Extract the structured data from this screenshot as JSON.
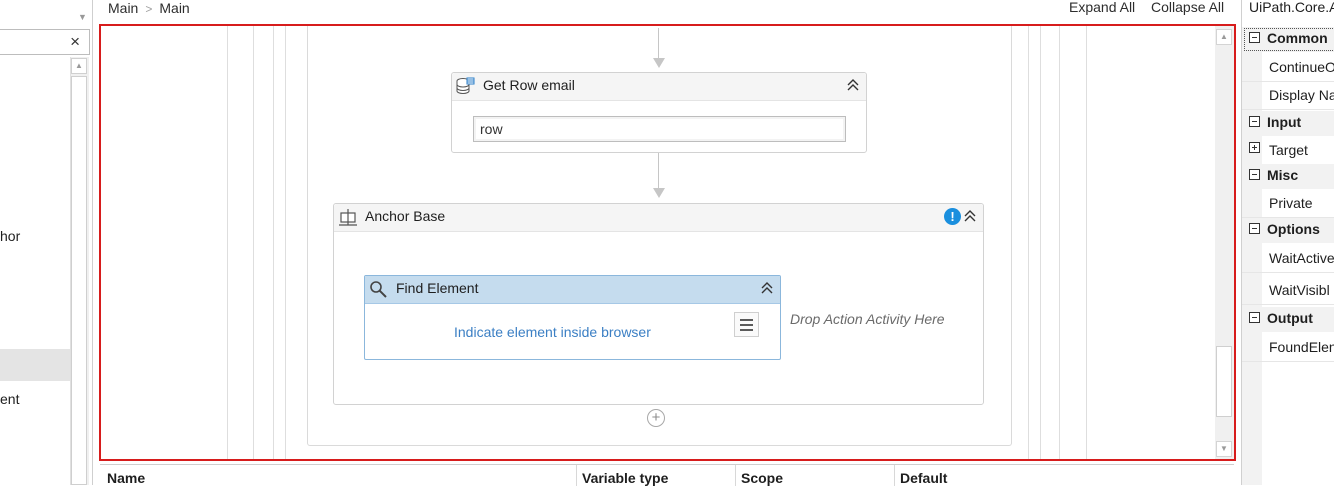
{
  "left_panel": {
    "items": [
      {
        "label": "hor"
      },
      {
        "label": "ent"
      }
    ],
    "clear_glyph": "×"
  },
  "breadcrumb": {
    "items": [
      "Main",
      "Main"
    ]
  },
  "toolbar": {
    "expand_all": "Expand All",
    "collapse_all": "Collapse All"
  },
  "canvas": {
    "get_row": {
      "title": "Get Row email",
      "input_value": "row",
      "icon": "data-row-icon"
    },
    "anchor_base": {
      "title": "Anchor Base",
      "icon": "anchor-icon",
      "warning_glyph": "!"
    },
    "find_element": {
      "title": "Find Element",
      "indicate_link": "Indicate element inside browser",
      "icon": "search-icon"
    },
    "drop_hint": "Drop Action Activity Here",
    "add_glyph": "+"
  },
  "variables_panel": {
    "columns": [
      "Name",
      "Variable type",
      "Scope",
      "Default"
    ]
  },
  "properties": {
    "title": "UiPath.Core.A",
    "categories": [
      {
        "label": "Common",
        "items": [
          "ContinueO",
          "Display Na"
        ]
      },
      {
        "label": "Input",
        "items": [
          "Target"
        ]
      },
      {
        "label": "Misc",
        "items": [
          "Private"
        ]
      },
      {
        "label": "Options",
        "items": [
          "WaitActive",
          "WaitVisibl"
        ]
      },
      {
        "label": "Output",
        "items": [
          "FoundElen"
        ]
      }
    ]
  },
  "colors": {
    "canvas_border": "#d71c1c",
    "find_header": "#c5dcee",
    "link": "#3b7fc4",
    "warning": "#1a8fde"
  }
}
